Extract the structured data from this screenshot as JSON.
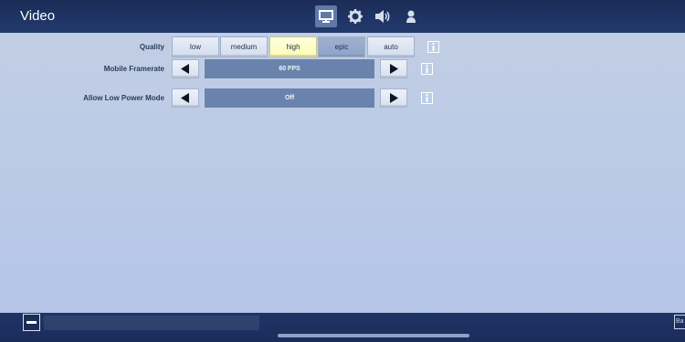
{
  "header": {
    "title": "Video",
    "tabs": [
      {
        "icon": "monitor-icon",
        "active": true
      },
      {
        "icon": "gear-icon",
        "active": false
      },
      {
        "icon": "speaker-icon",
        "active": false
      },
      {
        "icon": "person-icon",
        "active": false
      }
    ]
  },
  "settings": {
    "quality": {
      "label": "Quality",
      "options": [
        "low",
        "medium",
        "high",
        "epic",
        "auto"
      ],
      "selected": "high"
    },
    "framerate": {
      "label": "Mobile Framerate",
      "value": "60 FPS"
    },
    "low_power": {
      "label": "Allow Low Power Mode",
      "value": "Off"
    }
  },
  "footer": {
    "back_label": "Ba"
  },
  "colors": {
    "topbar": "#1b2d57",
    "selected": "#fbfbb8",
    "value_box": "#6a83ad"
  }
}
